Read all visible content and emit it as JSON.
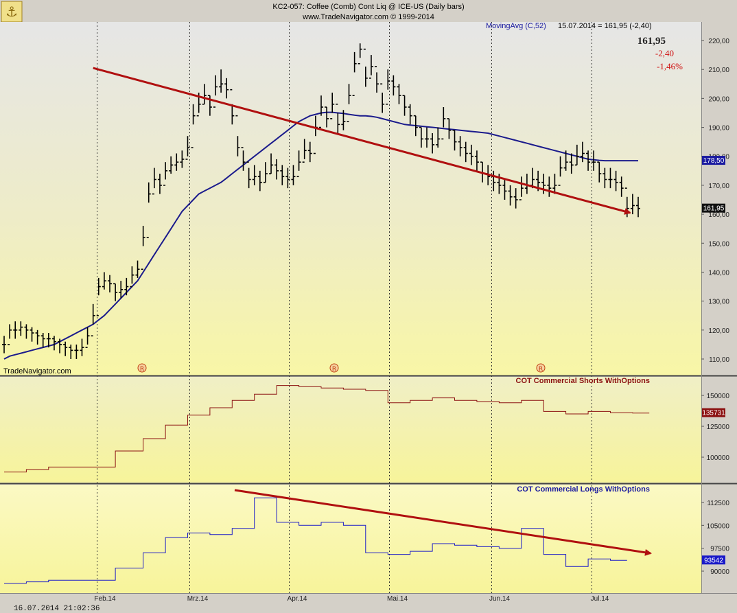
{
  "header": {
    "title": "KC2-057:  Coffee (Comb) Cont Liq @ ICE-US  (Daily bars)",
    "subtitle": "www.TradeNavigator.com © 1999-2014",
    "watermark": "TradeNavigator.com",
    "timestamp": "16.07.2014  21:02:36"
  },
  "readout": {
    "indicator": "MovingAvg (C,52)",
    "values": "15.07.2014 = 161,95 (-2,40)",
    "last_price": "161,95",
    "change": "-2,40",
    "change_pct": "-1,46%"
  },
  "colors": {
    "panel_bg_top": "#e4e4e4",
    "panel_bg_bottom": "#f7f49a",
    "price_bars": "#000000",
    "moving_avg": "#1b1b8c",
    "shorts": "#8b1010",
    "longs": "#1a1ac8",
    "trend_arrow": "#b01010"
  },
  "chart_data": [
    {
      "type": "ohlc",
      "name": "price",
      "ylim": [
        105,
        225
      ],
      "yticks": [
        "220,00",
        "210,00",
        "200,00",
        "190,00",
        "180,00",
        "170,00",
        "160,00",
        "150,00",
        "140,00",
        "130,00",
        "120,00",
        "110,00"
      ],
      "last_value_tag": "161,95",
      "ma_value_tag": "178,50",
      "x_labels": [
        "Feb.14",
        "Mrz.14",
        "Apr.14",
        "Mai.14",
        "Jun.14",
        "Jul.14"
      ],
      "close": [
        115,
        120,
        120,
        121,
        120,
        119,
        118,
        117,
        117,
        116,
        115,
        114,
        113,
        113,
        114,
        118,
        125,
        135,
        137,
        136,
        133,
        134,
        135,
        139,
        141,
        152,
        167,
        172,
        170,
        175,
        177,
        178,
        179,
        183,
        194,
        198,
        201,
        197,
        204,
        205,
        203,
        194,
        183,
        178,
        172,
        173,
        171,
        174,
        177,
        175,
        173,
        172,
        173,
        178,
        182,
        181,
        190,
        197,
        193,
        198,
        191,
        192,
        201,
        212,
        217,
        207,
        211,
        205,
        198,
        206,
        204,
        201,
        197,
        194,
        190,
        186,
        186,
        184,
        186,
        193,
        189,
        185,
        183,
        181,
        180,
        178,
        174,
        173,
        171,
        170,
        168,
        166,
        165,
        169,
        170,
        172,
        171,
        170,
        169,
        170,
        176,
        178,
        177,
        180,
        181,
        178,
        178,
        174,
        172,
        172,
        171,
        169,
        162,
        163,
        162
      ],
      "high": [
        118,
        122,
        123,
        123,
        122,
        121,
        120,
        119,
        119,
        118,
        117,
        116,
        115,
        115,
        117,
        121,
        129,
        138,
        140,
        139,
        136,
        137,
        138,
        142,
        144,
        156,
        171,
        176,
        174,
        178,
        180,
        181,
        182,
        187,
        198,
        202,
        205,
        201,
        208,
        210,
        207,
        198,
        187,
        182,
        176,
        177,
        175,
        178,
        181,
        179,
        177,
        176,
        177,
        182,
        186,
        185,
        194,
        201,
        197,
        202,
        195,
        196,
        205,
        216,
        219,
        211,
        215,
        209,
        202,
        210,
        208,
        205,
        201,
        198,
        194,
        190,
        190,
        188,
        190,
        197,
        193,
        189,
        187,
        185,
        184,
        182,
        178,
        177,
        175,
        174,
        172,
        170,
        169,
        173,
        174,
        176,
        175,
        174,
        173,
        174,
        180,
        182,
        181,
        184,
        185,
        182,
        182,
        178,
        176,
        176,
        175,
        173,
        166,
        167,
        166
      ],
      "low": [
        112,
        117,
        117,
        118,
        117,
        116,
        115,
        114,
        114,
        113,
        112,
        111,
        110,
        110,
        111,
        115,
        122,
        132,
        134,
        133,
        130,
        131,
        132,
        136,
        138,
        149,
        164,
        169,
        167,
        172,
        174,
        175,
        176,
        180,
        191,
        195,
        198,
        194,
        201,
        202,
        200,
        191,
        180,
        175,
        169,
        170,
        168,
        171,
        174,
        172,
        170,
        169,
        170,
        175,
        179,
        178,
        187,
        194,
        190,
        195,
        188,
        189,
        198,
        209,
        214,
        204,
        208,
        202,
        195,
        203,
        201,
        198,
        194,
        191,
        187,
        183,
        183,
        181,
        183,
        190,
        186,
        182,
        180,
        178,
        177,
        175,
        171,
        170,
        168,
        167,
        165,
        163,
        162,
        166,
        167,
        169,
        168,
        167,
        166,
        167,
        173,
        175,
        174,
        177,
        178,
        175,
        175,
        171,
        169,
        169,
        168,
        166,
        159,
        160,
        159
      ],
      "ma52": [
        110,
        111,
        111.5,
        112,
        112.5,
        113,
        113.5,
        114,
        114.5,
        115,
        116,
        117,
        118,
        119,
        120,
        121,
        122,
        123.5,
        125,
        127,
        129,
        131,
        133,
        135,
        137,
        140,
        143,
        146,
        149,
        152,
        155,
        158,
        161,
        163,
        165,
        167,
        168,
        169,
        170,
        171,
        172.5,
        174,
        175.5,
        177,
        178.5,
        180,
        181.5,
        183,
        184.5,
        186,
        187.5,
        189,
        190.5,
        192,
        193,
        194,
        194.5,
        195,
        195.2,
        195.2,
        195,
        194.8,
        194.5,
        194.2,
        194,
        194,
        193.8,
        193.5,
        193,
        192.5,
        192,
        191.5,
        191,
        190.8,
        190.6,
        190.4,
        190.2,
        190,
        189.8,
        189.6,
        189.4,
        189.2,
        189,
        188.8,
        188.6,
        188.4,
        188.2,
        188,
        187.5,
        187,
        186.5,
        186,
        185.5,
        185,
        184.5,
        184,
        183.5,
        183,
        182.5,
        182,
        181.5,
        181,
        180.5,
        180,
        179.5,
        179,
        178.8,
        178.6,
        178.5,
        178.5,
        178.5,
        178.5,
        178.5,
        178.5,
        178.5
      ],
      "trend": {
        "from": [
          16,
          210.5
        ],
        "to": [
          115,
          160.5
        ]
      }
    },
    {
      "type": "line",
      "name": "COT Commercial Shorts WithOptions",
      "ylim": [
        85000,
        165000
      ],
      "yticks": [
        "150000",
        "125000",
        "100000"
      ],
      "last_value_tag": "135731",
      "values": [
        88000,
        88000,
        88000,
        88000,
        90000,
        90000,
        90000,
        90000,
        92000,
        92000,
        92000,
        92000,
        92000,
        92000,
        92000,
        92000,
        92000,
        92000,
        92000,
        92000,
        105000,
        105000,
        105000,
        105000,
        105000,
        115000,
        115000,
        115000,
        115000,
        126000,
        126000,
        126000,
        126000,
        134000,
        134000,
        134000,
        134000,
        140000,
        140000,
        140000,
        140000,
        146000,
        146000,
        146000,
        146000,
        151000,
        151000,
        151000,
        151000,
        158000,
        158000,
        158000,
        158000,
        157000,
        157000,
        157000,
        157000,
        156000,
        156000,
        156000,
        156000,
        155000,
        155000,
        155000,
        155000,
        154000,
        154000,
        154000,
        154000,
        144000,
        144000,
        144000,
        144000,
        146000,
        146000,
        146000,
        146000,
        148000,
        148000,
        148000,
        148000,
        146000,
        146000,
        146000,
        146000,
        145000,
        145000,
        145000,
        145000,
        144000,
        144000,
        144000,
        144000,
        146000,
        146000,
        146000,
        146000,
        137000,
        137000,
        137000,
        137000,
        135000,
        135000,
        135000,
        135000,
        137000,
        137000,
        137000,
        137000,
        136000,
        136000,
        136000,
        136000,
        135731,
        135731,
        135731,
        135731
      ]
    },
    {
      "type": "line",
      "name": "COT Commercial Longs WithOptions",
      "ylim": [
        84000,
        118000
      ],
      "yticks": [
        "112500",
        "105000",
        "97500",
        "90000"
      ],
      "last_value_tag": "93542",
      "values": [
        86000,
        86000,
        86000,
        86000,
        86500,
        86500,
        86500,
        86500,
        87000,
        87000,
        87000,
        87000,
        87000,
        87000,
        87000,
        87000,
        87000,
        87000,
        87000,
        87000,
        91000,
        91000,
        91000,
        91000,
        91000,
        96000,
        96000,
        96000,
        96000,
        101000,
        101000,
        101000,
        101000,
        102500,
        102500,
        102500,
        102500,
        102000,
        102000,
        102000,
        102000,
        104000,
        104000,
        104000,
        104000,
        114000,
        114000,
        114000,
        114000,
        106000,
        106000,
        106000,
        106000,
        105000,
        105000,
        105000,
        105000,
        106000,
        106000,
        106000,
        106000,
        105000,
        105000,
        105000,
        105000,
        96000,
        96000,
        96000,
        96000,
        95500,
        95500,
        95500,
        95500,
        96500,
        96500,
        96500,
        96500,
        99000,
        99000,
        99000,
        99000,
        98500,
        98500,
        98500,
        98500,
        98000,
        98000,
        98000,
        98000,
        97500,
        97500,
        97500,
        97500,
        104000,
        104000,
        104000,
        104000,
        95500,
        95500,
        95500,
        95500,
        91500,
        91500,
        91500,
        91500,
        94000,
        94000,
        94000,
        94000,
        93542,
        93542,
        93542,
        93542
      ]
    }
  ]
}
